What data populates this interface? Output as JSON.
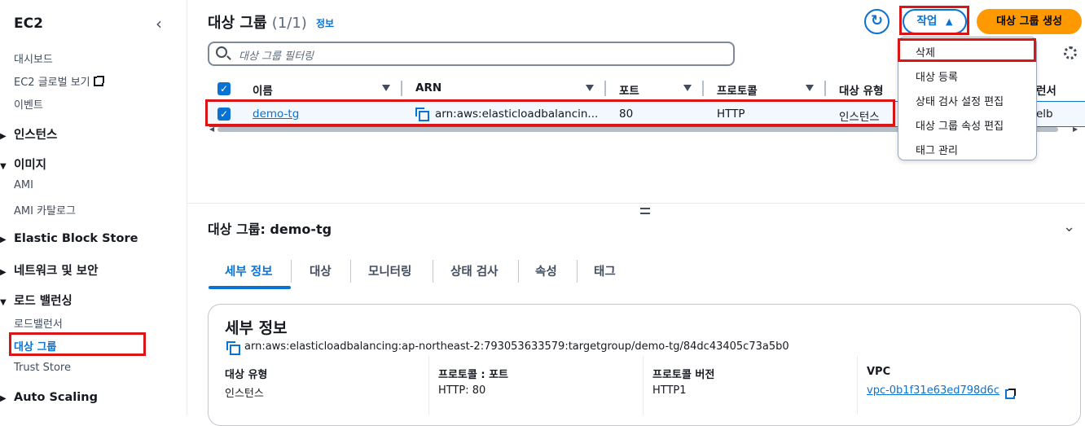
{
  "sidebar": {
    "title": "EC2",
    "items": [
      {
        "label": "대시보드"
      },
      {
        "label": "EC2 글로벌 보기"
      },
      {
        "label": "이벤트"
      }
    ],
    "sections": [
      {
        "label": "인스턴스"
      },
      {
        "label": "이미지",
        "items": [
          "AMI",
          "AMI 카탈로그"
        ]
      },
      {
        "label": "Elastic Block Store"
      },
      {
        "label": "네트워크 및 보안"
      },
      {
        "label": "로드 밸런싱",
        "items": [
          "로드밸런서",
          "대상 그룹",
          "Trust Store"
        ]
      },
      {
        "label": "Auto Scaling"
      }
    ]
  },
  "header": {
    "title": "대상 그룹",
    "count": "(1/1)",
    "info": "정보",
    "actions_label": "작업",
    "create_label": "대상 그룹 생성",
    "filter_placeholder": "대상 그룹 필터링"
  },
  "table": {
    "columns": [
      "이름",
      "ARN",
      "포트",
      "프로토콜",
      "대상 유형",
      "로드밸런서"
    ],
    "visible_last_column": "런서",
    "rows": [
      {
        "name": "demo-tg",
        "arn": "arn:aws:elasticloadbalancin...",
        "port": "80",
        "protocol": "HTTP",
        "target_type": "인스턴스",
        "lb": "elb"
      }
    ]
  },
  "actions_menu": {
    "items": [
      "삭제",
      "대상 등록",
      "상태 검사 설정 편집",
      "대상 그룹 속성 편집",
      "태그 관리"
    ]
  },
  "details": {
    "title": "대상 그룹: demo-tg",
    "tabs": [
      "세부 정보",
      "대상",
      "모니터링",
      "상태 검사",
      "속성",
      "태그"
    ],
    "card_title": "세부 정보",
    "arn": "arn:aws:elasticloadbalancing:ap-northeast-2:793053633579:targetgroup/demo-tg/84dc43405c73a5b0",
    "fields": [
      {
        "key": "대상 유형",
        "value": "인스턴스"
      },
      {
        "key": "프로토콜 : 포트",
        "value": "HTTP: 80"
      },
      {
        "key": "프로토콜 버전",
        "value": "HTTP1"
      },
      {
        "key": "VPC",
        "value": "vpc-0b1f31e63ed798d6c"
      }
    ]
  },
  "colors": {
    "accent": "#0972d3",
    "create_button": "#ff9900",
    "highlight": "#d91515"
  }
}
